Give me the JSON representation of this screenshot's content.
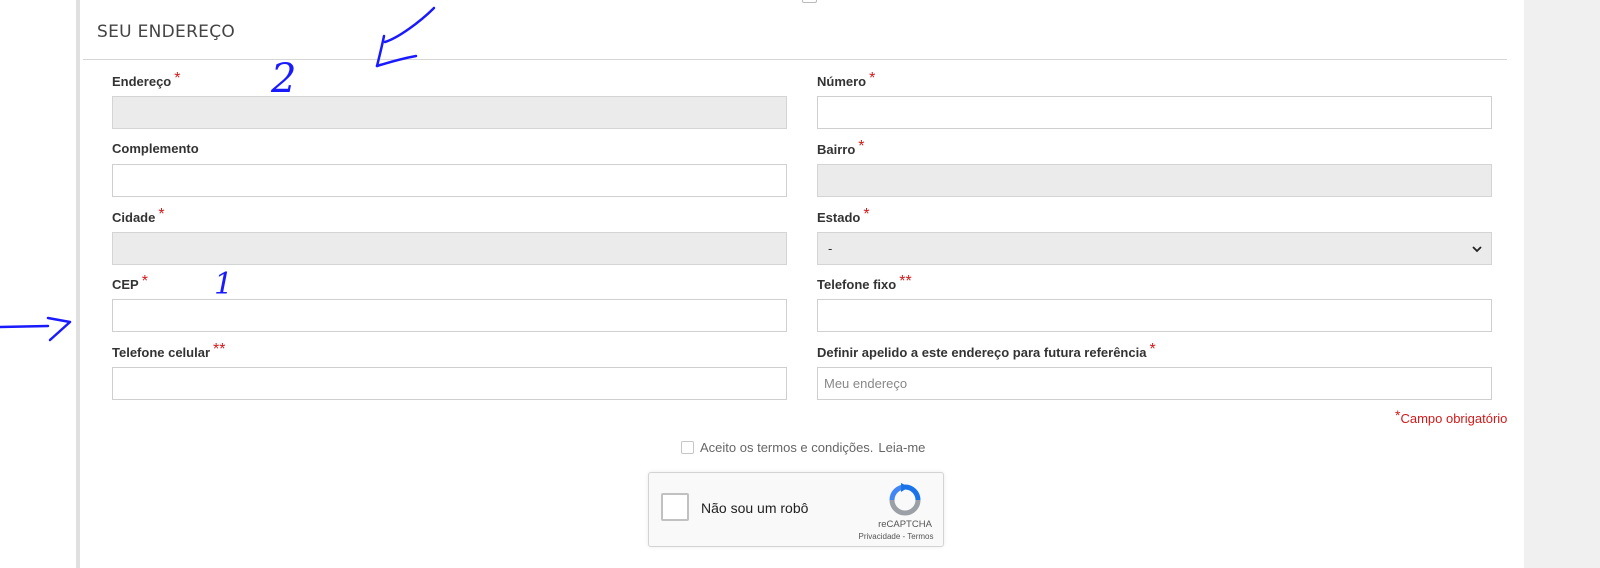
{
  "section": {
    "title": "SEU ENDEREÇO"
  },
  "fields": {
    "endereco": {
      "label": "Endereço",
      "required": "*",
      "value": ""
    },
    "numero": {
      "label": "Número",
      "required": "*",
      "value": ""
    },
    "complemento": {
      "label": "Complemento",
      "value": ""
    },
    "bairro": {
      "label": "Bairro",
      "required": "*",
      "value": ""
    },
    "cidade": {
      "label": "Cidade",
      "required": "*",
      "value": ""
    },
    "estado": {
      "label": "Estado",
      "required": "*",
      "selected": "-"
    },
    "cep": {
      "label": "CEP",
      "required": "*",
      "value": ""
    },
    "telefone_fixo": {
      "label": "Telefone fixo",
      "required": "**",
      "value": ""
    },
    "telefone_celular": {
      "label": "Telefone celular",
      "required": "**",
      "value": ""
    },
    "apelido": {
      "label": "Definir apelido a este endereço para futura referência",
      "required": "*",
      "value": "",
      "placeholder": "Meu endereço"
    }
  },
  "required_note": {
    "star": "*",
    "text": "Campo obrigatório"
  },
  "terms": {
    "text": "Aceito os termos e condições.",
    "link": "Leia-me"
  },
  "recaptcha": {
    "label": "Não sou um robô",
    "brand": "reCAPTCHA",
    "privacy": "Privacidade",
    "separator": " - ",
    "terms": "Termos"
  },
  "annotations": {
    "number_2": "2",
    "number_1": "1"
  },
  "colors": {
    "required": "#d11a1a",
    "disabled_field": "#ebebeb",
    "annotation_ink": "#1a1aff"
  }
}
